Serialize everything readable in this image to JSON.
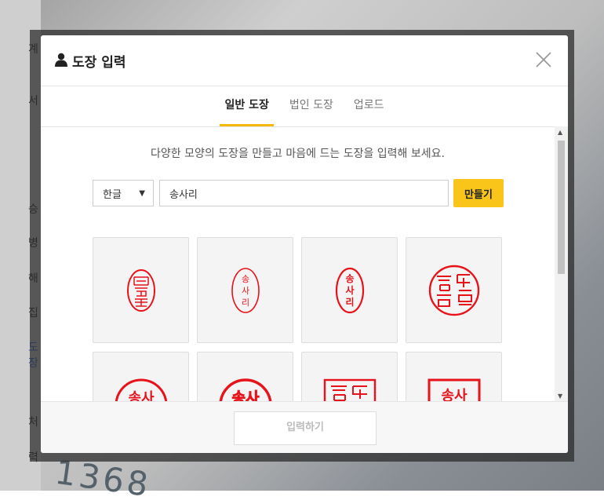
{
  "background": {
    "side_labels": [
      "계",
      "서",
      "승",
      "병",
      "해",
      "집",
      "도장",
      "처",
      "력"
    ],
    "number": "1368"
  },
  "modal": {
    "title": "도장 입력",
    "title_icon": "user-icon",
    "close_icon": "close-icon",
    "tabs": [
      {
        "label": "일반 도장",
        "active": true
      },
      {
        "label": "법인 도장",
        "active": false
      },
      {
        "label": "업로드",
        "active": false
      }
    ],
    "guide_text": "다양한 모양의 도장을 만들고 마음에 드는 도장을 입력해 보세요.",
    "language_select": {
      "value": "한글"
    },
    "name_input": {
      "value": "송사리"
    },
    "make_button": "만들기",
    "stamps": [
      {
        "style": "oval-vertical-calligraphy",
        "text": "송사리"
      },
      {
        "style": "oval-vertical-plain",
        "text": "송사리"
      },
      {
        "style": "oval-vertical-bold",
        "text": "송사리"
      },
      {
        "style": "circle-seal-script",
        "text": "송사리"
      },
      {
        "style": "circle-bold",
        "text": "송사리"
      },
      {
        "style": "circle-extra-bold",
        "text": "송사리"
      },
      {
        "style": "square-seal-script",
        "text": "송사리"
      },
      {
        "style": "square-bold",
        "text": "송사리"
      }
    ],
    "submit_button": "입력하기"
  },
  "colors": {
    "accent": "#f9c51a",
    "stamp_red": "#e8121a",
    "active_tab_underline": "#f5b90a"
  }
}
